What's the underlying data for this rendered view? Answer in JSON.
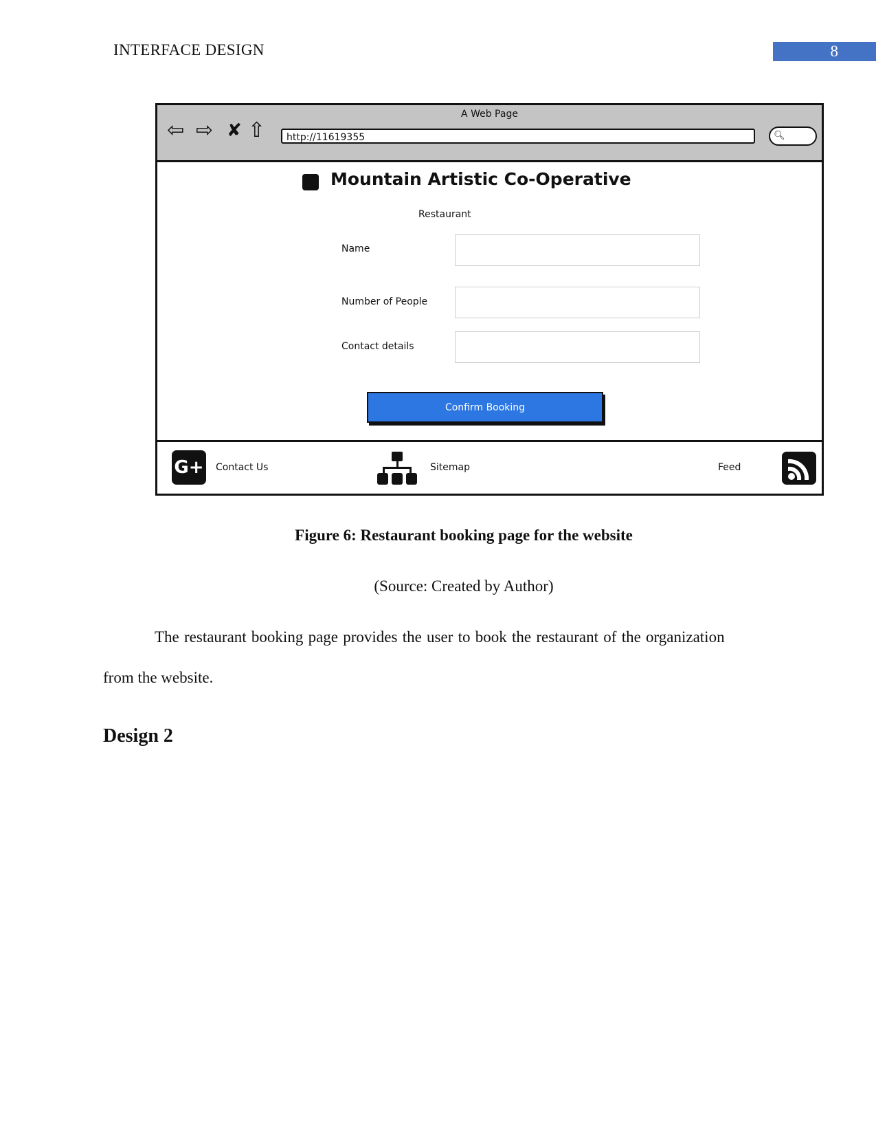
{
  "header": {
    "title": "INTERFACE DESIGN",
    "page_number": "8",
    "accent": "#4472c4"
  },
  "mockup": {
    "window_title": "A Web Page",
    "url": "http://11619355",
    "site_title": "Mountain Artistic Co-Operative",
    "section": "Restaurant",
    "fields": [
      {
        "label": "Name",
        "value": ""
      },
      {
        "label": "Number of People",
        "value": ""
      },
      {
        "label": "Contact details",
        "value": ""
      }
    ],
    "confirm_label": "Confirm Booking",
    "button_color": "#2d77e3",
    "footer": {
      "contact": "Contact Us",
      "sitemap": "Sitemap",
      "feed": "Feed"
    }
  },
  "caption": "Figure 6: Restaurant booking page for the website",
  "source": "(Source: Created by Author)",
  "paragraph_line1": "The restaurant booking page provides the user to book the restaurant of the organization",
  "paragraph_line2": "from the website.",
  "heading": "Design 2"
}
